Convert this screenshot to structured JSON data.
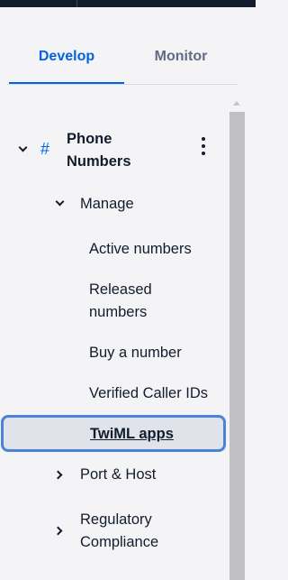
{
  "tabs": [
    {
      "label": "Develop",
      "active": true
    },
    {
      "label": "Monitor",
      "active": false
    }
  ],
  "nav": {
    "section": {
      "label": "Phone Numbers",
      "label_line1": "Phone",
      "label_line2": "Numbers",
      "icon": "hash-icon",
      "icon_glyph": "#",
      "expanded": true
    },
    "manage": {
      "label": "Manage",
      "expanded": true,
      "items": [
        {
          "label": "Active numbers"
        },
        {
          "label": "Released numbers",
          "line1": "Released",
          "line2": "numbers"
        },
        {
          "label": "Buy a number"
        },
        {
          "label": "Verified Caller IDs"
        },
        {
          "label": "TwiML apps",
          "selected": true
        }
      ]
    },
    "port_host": {
      "label": "Port & Host",
      "expanded": false
    },
    "regulatory": {
      "label": "Regulatory Compliance",
      "line1": "Regulatory",
      "line2": "Compliance",
      "expanded": false
    }
  },
  "colors": {
    "accent": "#0263e0",
    "selected_border": "#4a83d8",
    "selected_bg": "#e1e3ea",
    "text": "#121c2d",
    "muted": "#606b85",
    "topbar": "#121c2d"
  }
}
